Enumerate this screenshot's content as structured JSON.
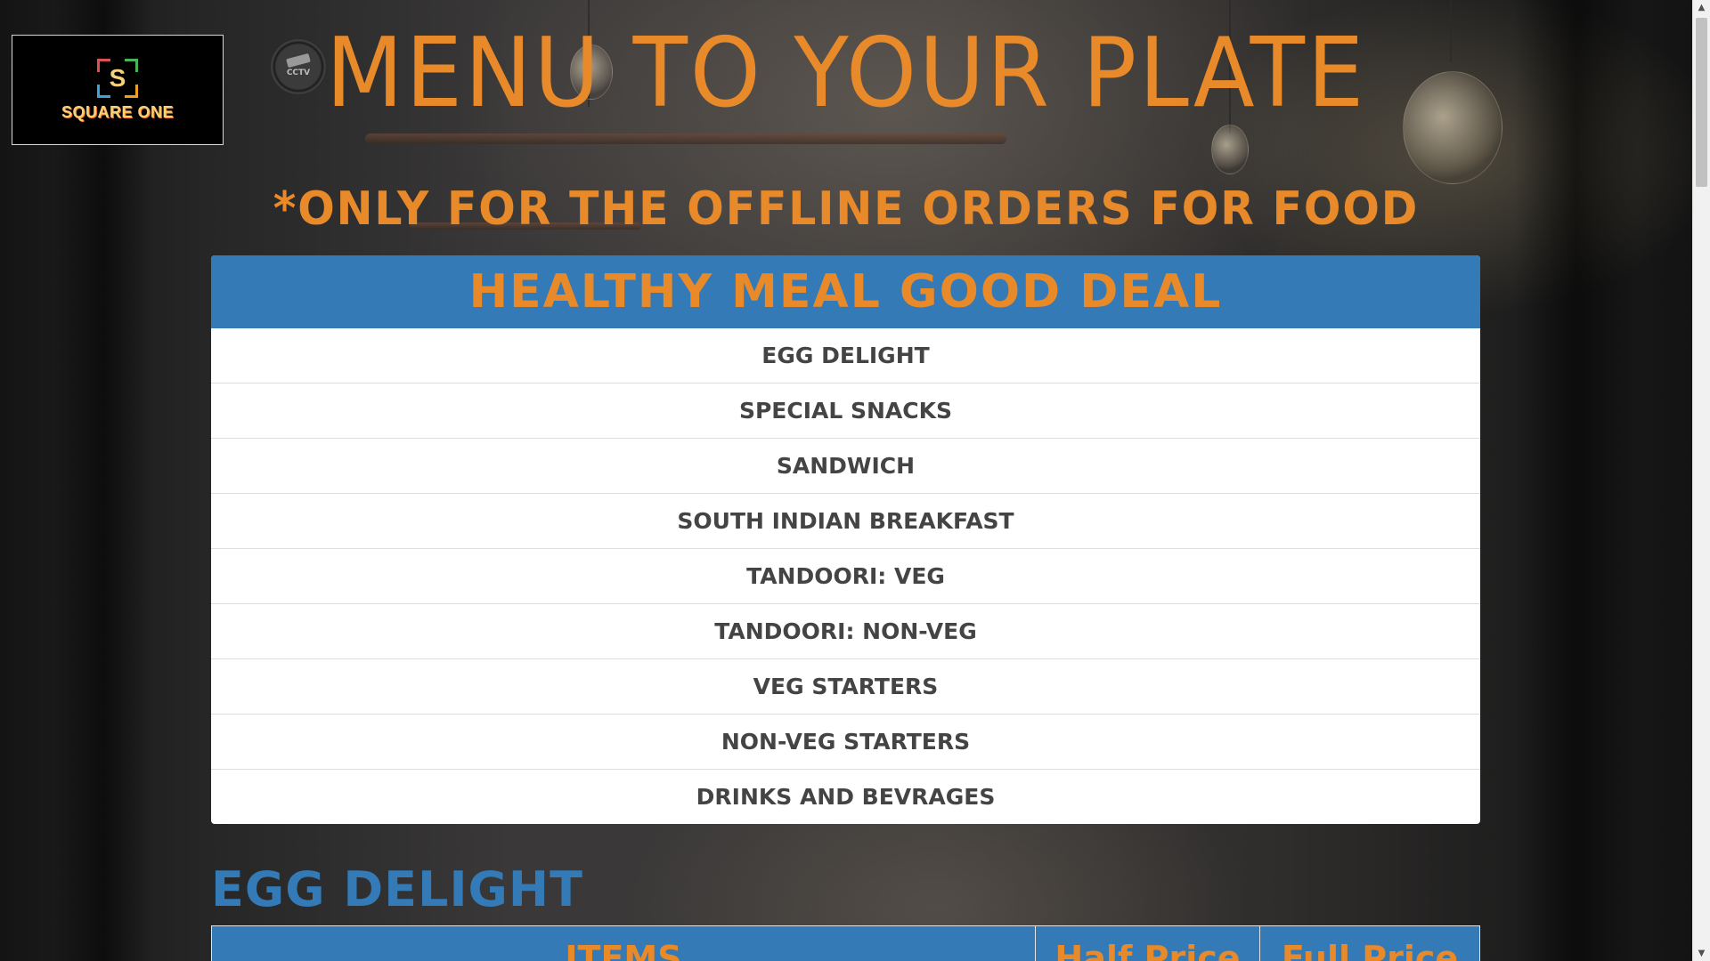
{
  "logo": {
    "letter": "S",
    "text": "SQUARE ONE"
  },
  "cctv_sign": {
    "label": "CCTV"
  },
  "header": {
    "title": "MENU TO YOUR PLATE",
    "subtitle": "*ONLY FOR THE OFFLINE ORDERS FOR FOOD"
  },
  "category_panel": {
    "heading": "HEALTHY MEAL GOOD DEAL",
    "items": [
      {
        "label": "EGG DELIGHT"
      },
      {
        "label": "SPECIAL SNACKS"
      },
      {
        "label": "SANDWICH"
      },
      {
        "label": "SOUTH INDIAN BREAKFAST"
      },
      {
        "label": "TANDOORI: VEG"
      },
      {
        "label": "TANDOORI: NON-VEG"
      },
      {
        "label": "VEG STARTERS"
      },
      {
        "label": "NON-VEG STARTERS"
      },
      {
        "label": "DRINKS AND BEVRAGES"
      }
    ]
  },
  "egg_section": {
    "heading": "EGG DELIGHT",
    "columns": [
      "ITEMS",
      "Half Price",
      "Full Price"
    ]
  },
  "colors": {
    "accent_orange": "#e88a2a",
    "panel_blue": "#337ab7",
    "list_text": "#444444"
  },
  "icons": [
    "square-one-logo-icon",
    "cctv-icon",
    "scroll-up-arrow-icon",
    "scroll-down-arrow-icon"
  ]
}
